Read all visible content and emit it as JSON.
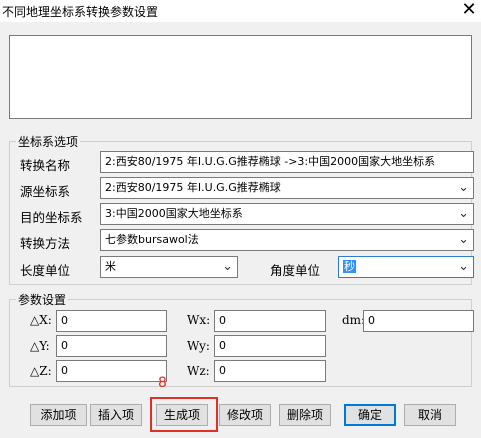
{
  "window": {
    "title": "不同地理坐标系转换参数设置",
    "close_glyph": "✕"
  },
  "coord_group": {
    "title": "坐标系选项",
    "rows": [
      {
        "label": "转换名称",
        "value": "2:西安80/1975 年I.U.G.G推荐椭球 ->3:中国2000国家大地坐标系"
      },
      {
        "label": "源坐标系",
        "value": "2:西安80/1975 年I.U.G.G推荐椭球"
      },
      {
        "label": "目的坐标系",
        "value": "3:中国2000国家大地坐标系"
      },
      {
        "label": "转换方法",
        "value": "七参数bursawol法"
      }
    ],
    "length_unit": {
      "label": "长度单位",
      "value": "米"
    },
    "angle_unit": {
      "label": "角度单位",
      "value": "秒"
    }
  },
  "param_group": {
    "title": "参数设置",
    "dx": {
      "label": "△X:",
      "value": "0"
    },
    "dy": {
      "label": "△Y:",
      "value": "0"
    },
    "dz": {
      "label": "△Z:",
      "value": "0"
    },
    "wx": {
      "label": "Wx:",
      "value": "0"
    },
    "wy": {
      "label": "Wy:",
      "value": "0"
    },
    "wz": {
      "label": "Wz:",
      "value": "0"
    },
    "dm": {
      "label": "dm:",
      "value": "0"
    }
  },
  "annotation": {
    "step_number": "8",
    "color": "#e0302a"
  },
  "buttons": {
    "add": "添加项",
    "insert": "插入项",
    "generate": "生成项",
    "modify": "修改项",
    "delete": "删除项",
    "ok": "确定",
    "cancel": "取消"
  },
  "icons": {
    "dropdown": "chevron-down-icon",
    "close": "close-icon"
  }
}
